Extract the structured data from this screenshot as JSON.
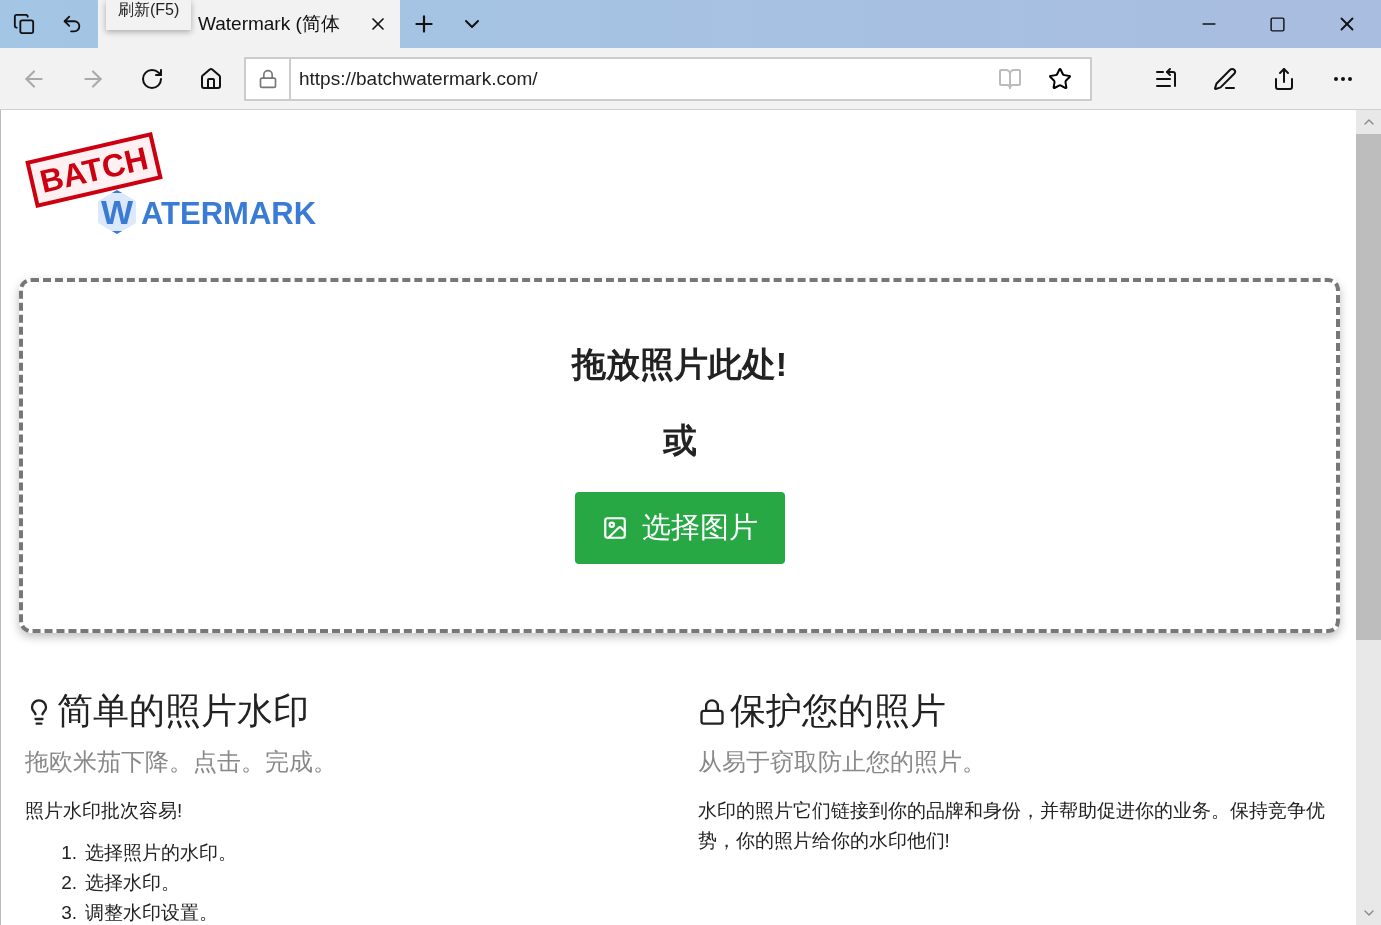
{
  "browser": {
    "tooltip": "刷新(F5)",
    "tab_title": "Watermark (简体",
    "url": "https://batchwatermark.com/"
  },
  "logo": {
    "batch": "BATCH",
    "initial": "W",
    "rest": "ATERMARK"
  },
  "dropzone": {
    "title": "拖放照片此处!",
    "or": "或",
    "button": "选择图片"
  },
  "features": [
    {
      "kind": "tip",
      "title": "简单的照片水印",
      "subtitle": "拖欧米茄下降。点击。完成。",
      "body": "照片水印批次容易!",
      "steps": [
        {
          "number": "1.",
          "text": "选择照片的水印。"
        },
        {
          "number": "2.",
          "text": "选择水印。"
        },
        {
          "number": "3.",
          "text": "调整水印设置。"
        }
      ]
    },
    {
      "kind": "security",
      "title": "保护您的照片",
      "subtitle": "从易于窃取防止您的照片。",
      "body": "水印的照片它们链接到你的品牌和身份，并帮助促进你的业务。保持竞争优势，你的照片给你的水印他们!"
    }
  ]
}
